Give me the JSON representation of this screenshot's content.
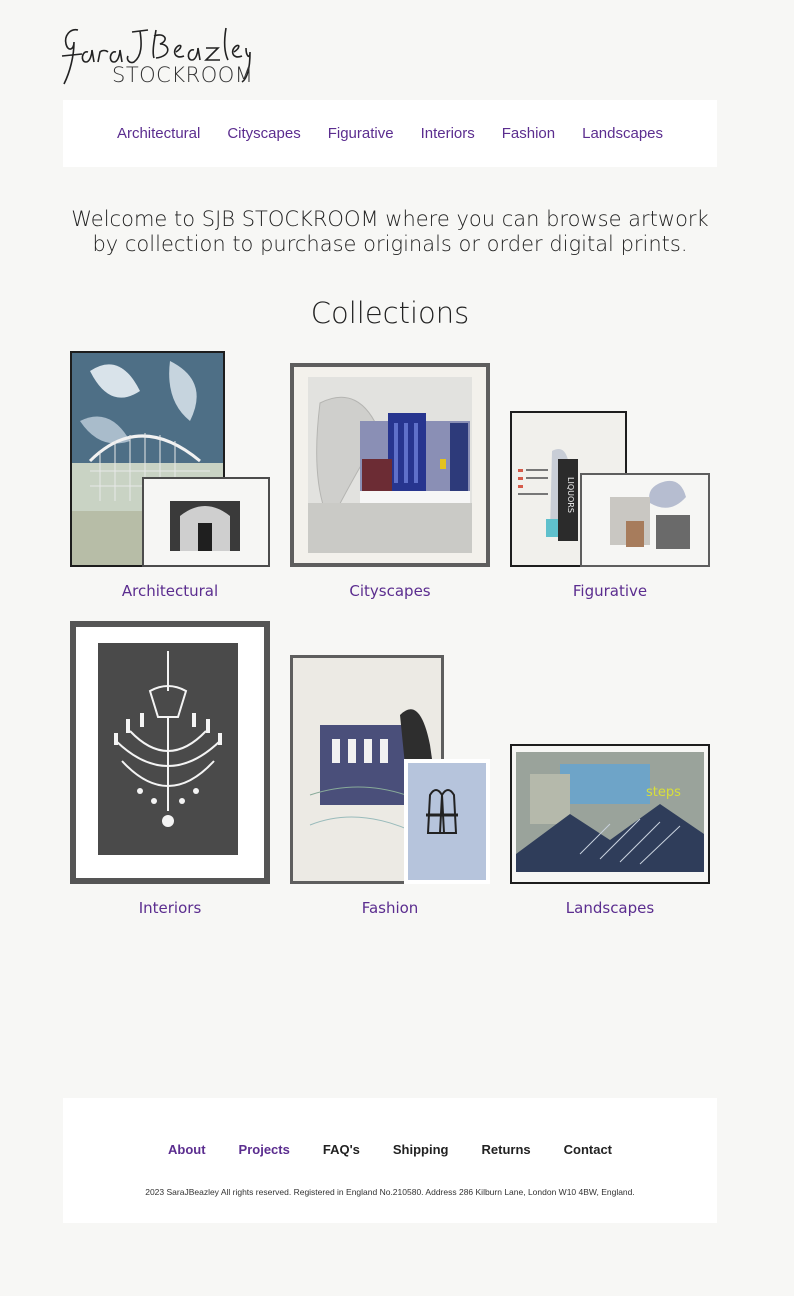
{
  "brand": {
    "logo_script": "Sara J Beazley",
    "logo_sub": "STOCKROOM"
  },
  "topnav": {
    "items": [
      "Architectural",
      "Cityscapes",
      "Figurative",
      "Interiors",
      "Fashion",
      "Landscapes"
    ]
  },
  "welcome": {
    "line1": "Welcome to SJB STOCKROOM where you can browse artwork",
    "line2": "by collection to purchase originals or order digital prints."
  },
  "collections": {
    "title": "Collections",
    "items": [
      {
        "label": "Architectural"
      },
      {
        "label": "Cityscapes"
      },
      {
        "label": "Figurative"
      },
      {
        "label": "Interiors"
      },
      {
        "label": "Fashion"
      },
      {
        "label": "Landscapes"
      }
    ]
  },
  "artwork_text": {
    "liquors": "LIQUORS",
    "steps": "steps"
  },
  "footer": {
    "links": [
      "About",
      "Projects",
      "FAQ's",
      "Shipping",
      "Returns",
      "Contact"
    ],
    "copyright": "2023 SaraJBeazley All rights reserved. Registered in England No.210580. Address 286 Kilburn Lane, London W10 4BW, England."
  },
  "colors": {
    "accent": "#5b2d8f",
    "background": "#f7f7f5",
    "panel": "#ffffff"
  }
}
